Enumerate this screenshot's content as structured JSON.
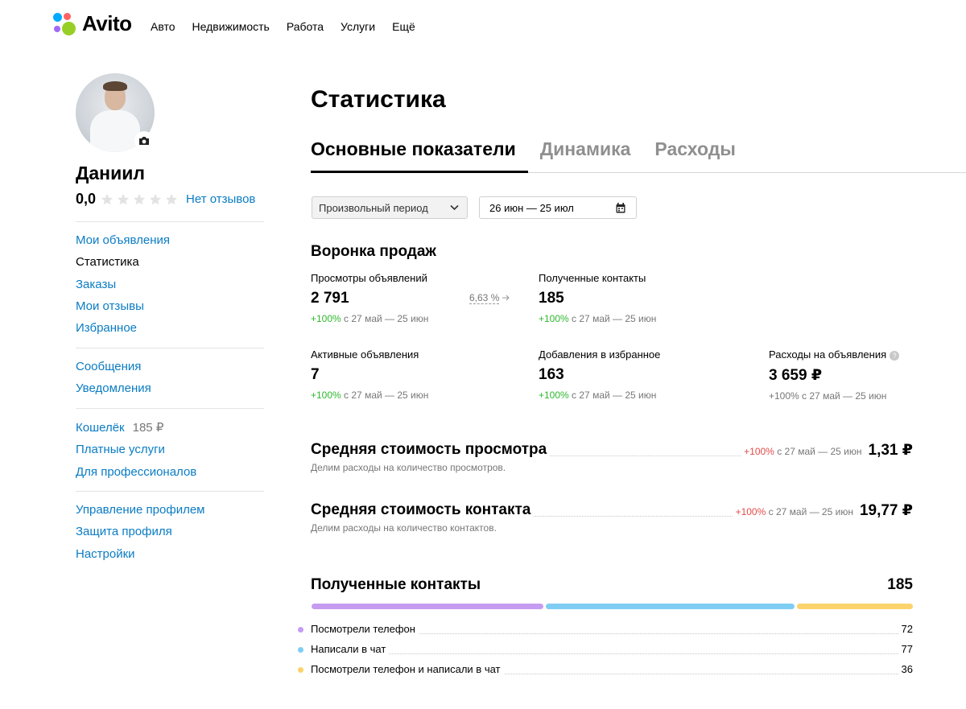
{
  "header": {
    "logo_text": "Avito",
    "nav": [
      "Авто",
      "Недвижимость",
      "Работа",
      "Услуги",
      "Ещё"
    ]
  },
  "profile": {
    "name": "Даниил",
    "rating": "0,0",
    "reviews_link": "Нет отзывов"
  },
  "sidebar": {
    "group1": [
      "Мои объявления",
      "Статистика",
      "Заказы",
      "Мои отзывы",
      "Избранное"
    ],
    "group2": [
      "Сообщения",
      "Уведомления"
    ],
    "wallet_label": "Кошелёк",
    "wallet_amount": "185 ₽",
    "group3": [
      "Платные услуги",
      "Для профессионалов"
    ],
    "group4": [
      "Управление профилем",
      "Защита профиля",
      "Настройки"
    ]
  },
  "page": {
    "title": "Статистика",
    "tabs": [
      "Основные показатели",
      "Динамика",
      "Расходы"
    ],
    "period_select": "Произвольный период",
    "date_range": "26 июн — 25 июл"
  },
  "funnel": {
    "title": "Воронка продаж",
    "conversion": "6,63",
    "conversion_unit": "%",
    "metrics": {
      "views": {
        "label": "Просмотры объявлений",
        "value": "2 791",
        "delta": "+100",
        "delta_unit": "%",
        "period": "с 27 май — 25 июн"
      },
      "contacts": {
        "label": "Полученные контакты",
        "value": "185",
        "delta": "+100",
        "delta_unit": "%",
        "period": "с 27 май — 25 июн"
      },
      "active": {
        "label": "Активные объявления",
        "value": "7",
        "delta": "+100",
        "delta_unit": "%",
        "period": "с 27 май — 25 июн"
      },
      "favorites": {
        "label": "Добавления в избранное",
        "value": "163",
        "delta": "+100",
        "delta_unit": "%",
        "period": "с 27 май — 25 июн"
      },
      "spend": {
        "label": "Расходы на объявления",
        "value": "3 659 ₽",
        "delta": "+100",
        "delta_unit": "%",
        "period": "с 27 май — 25 июн"
      }
    }
  },
  "costs": {
    "view": {
      "title": "Средняя стоимость просмотра",
      "delta": "+100",
      "delta_unit": "%",
      "period": "с 27 май — 25 июн",
      "value": "1,31 ₽",
      "subtitle": "Делим расходы на количество просмотров."
    },
    "contact": {
      "title": "Средняя стоимость контакта",
      "delta": "+100",
      "delta_unit": "%",
      "period": "с 27 май — 25 июн",
      "value": "19,77 ₽",
      "subtitle": "Делим расходы на количество контактов."
    }
  },
  "contacts_breakdown": {
    "title": "Полученные контакты",
    "total": "185",
    "items": [
      {
        "label": "Посмотрели телефон",
        "value": "72",
        "color": "#c59cf1"
      },
      {
        "label": "Написали в чат",
        "value": "77",
        "color": "#80cdf4"
      },
      {
        "label": "Посмотрели телефон и написали в чат",
        "value": "36",
        "color": "#fbd36d"
      }
    ]
  },
  "colors": {
    "link": "#0a7cc4",
    "positive": "#2eb82e",
    "negative": "#e44a4a",
    "logo_green": "#97cf26",
    "logo_blue": "#00aaff",
    "logo_red": "#ff6163",
    "logo_purple": "#a169f7"
  }
}
